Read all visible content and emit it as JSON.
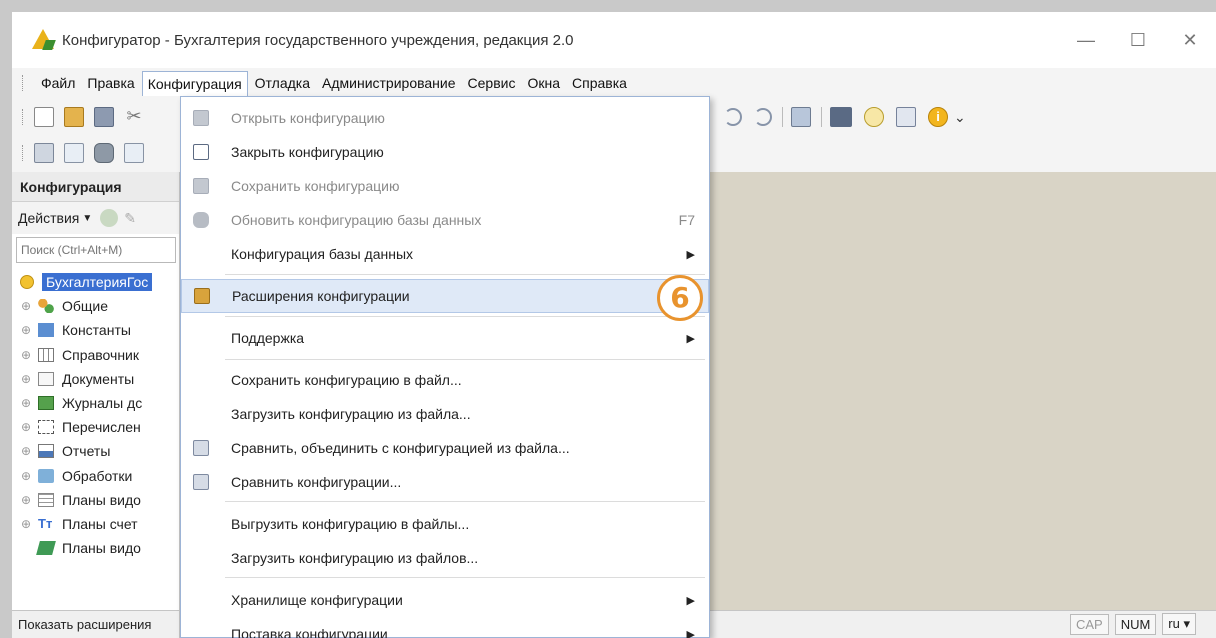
{
  "window": {
    "title": "Конфигуратор - Бухгалтерия государственного учреждения, редакция 2.0",
    "minimize": "—",
    "maximize": "☐",
    "close": "✕"
  },
  "menubar": {
    "items": [
      "Файл",
      "Правка",
      "Конфигурация",
      "Отладка",
      "Администрирование",
      "Сервис",
      "Окна",
      "Справка"
    ],
    "active": "Конфигурация"
  },
  "left_panel": {
    "header": "Конфигурация",
    "actions_label": "Действия",
    "search_placeholder": "Поиск (Ctrl+Alt+M)",
    "root_label": "БухгалтерияГос",
    "items": [
      {
        "label": "Общие",
        "icon": "common-icon"
      },
      {
        "label": "Константы",
        "icon": "constants-icon"
      },
      {
        "label": "Справочник",
        "icon": "catalogs-icon"
      },
      {
        "label": "Документы",
        "icon": "documents-icon"
      },
      {
        "label": "Журналы дс",
        "icon": "journals-icon"
      },
      {
        "label": "Перечислен",
        "icon": "enums-icon"
      },
      {
        "label": "Отчеты",
        "icon": "reports-icon"
      },
      {
        "label": "Обработки",
        "icon": "processing-icon"
      },
      {
        "label": "Планы видо",
        "icon": "chart-types-icon"
      },
      {
        "label": "Планы счет",
        "icon": "chart-accounts-icon"
      },
      {
        "label": "Планы видо",
        "icon": "calc-types-icon"
      }
    ]
  },
  "dropdown": {
    "items": [
      {
        "label": "Открыть конфигурацию",
        "disabled": true,
        "icon": "open-config-icon"
      },
      {
        "label": "Закрыть конфигурацию",
        "disabled": false,
        "icon": "close-config-icon"
      },
      {
        "label": "Сохранить конфигурацию",
        "disabled": true,
        "icon": "save-config-icon"
      },
      {
        "label": "Обновить конфигурацию базы данных",
        "disabled": true,
        "shortcut": "F7",
        "icon": "update-db-icon"
      },
      {
        "label": "Конфигурация базы данных",
        "submenu": true
      },
      {
        "label": "Расширения конфигурации",
        "highlight": true,
        "icon": "extensions-icon"
      },
      {
        "label": "Поддержка",
        "submenu": true
      },
      {
        "label": "Сохранить конфигурацию в файл..."
      },
      {
        "label": "Загрузить конфигурацию из файла..."
      },
      {
        "label": "Сравнить, объединить с конфигурацией из файла...",
        "icon": "compare-merge-icon"
      },
      {
        "label": "Сравнить конфигурации...",
        "icon": "compare-icon"
      },
      {
        "label": "Выгрузить конфигурацию в файлы..."
      },
      {
        "label": "Загрузить конфигурацию из файлов..."
      },
      {
        "label": "Хранилище конфигурации",
        "submenu": true
      },
      {
        "label": "Поставка конфигурации",
        "submenu": true
      }
    ]
  },
  "badge": "6",
  "status": {
    "left_text": "Показать расширения",
    "indicators": [
      "CAP",
      "NUM"
    ],
    "language": "ru"
  }
}
